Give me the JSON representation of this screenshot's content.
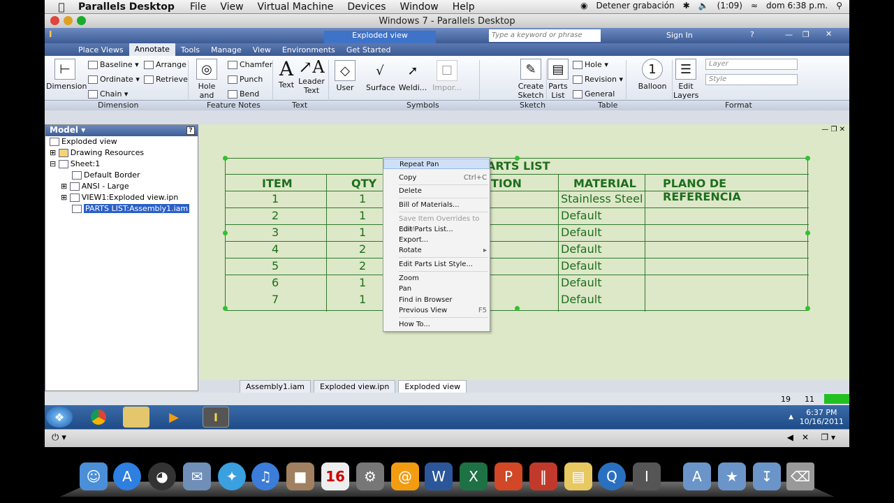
{
  "macbar": {
    "app": "Parallels Desktop",
    "menus": [
      "File",
      "View",
      "Virtual Machine",
      "Devices",
      "Window",
      "Help"
    ],
    "recording": "Detener grabación",
    "battery": "(1:09)",
    "clock": "dom 6:38 p.m."
  },
  "window_title": "Windows 7 - Parallels Desktop",
  "inventor": {
    "doc_title": "Exploded view",
    "search_placeholder": "Type a keyword or phrase",
    "sign_in": "Sign In",
    "tabs": [
      "Place Views",
      "Annotate",
      "Tools",
      "Manage",
      "View",
      "Environments",
      "Get Started"
    ],
    "ribbon": {
      "dimension": "Dimension",
      "baseline": "Baseline",
      "ordinate": "Ordinate",
      "chain": "Chain",
      "arrange": "Arrange",
      "retrieve": "Retrieve",
      "hole_thread": "Hole and Thread",
      "chamfer": "Chamfer",
      "punch": "Punch",
      "bend": "Bend",
      "text": "Text",
      "leader_text": "Leader Text",
      "user": "User",
      "surface": "Surface",
      "welding": "Weldi...",
      "import": "Impor...",
      "create_sketch": "Create Sketch",
      "parts_list": "Parts List",
      "hole": "Hole",
      "revision": "Revision",
      "general": "General",
      "balloon": "Balloon",
      "edit_layers": "Edit Layers",
      "layer": "Layer",
      "style": "Style"
    },
    "panels": [
      "Dimension",
      "Feature Notes",
      "Text",
      "Symbols",
      "Sketch",
      "Table",
      "Format"
    ],
    "browser": {
      "title": "Model",
      "items": [
        "Exploded view",
        "Drawing Resources",
        "Sheet:1",
        "Default Border",
        "ANSI - Large",
        "VIEW1:Exploded view.ipn",
        "PARTS LIST:Assembly1.iam"
      ]
    },
    "parts_list": {
      "title_fragment": "ARTS LIST",
      "headers": [
        "ITEM",
        "QTY",
        "TION",
        "MATERIAL",
        "PLANO DE REFERENCIA"
      ],
      "rows": [
        {
          "item": "1",
          "qty": "1",
          "material": "Stainless Steel"
        },
        {
          "item": "2",
          "qty": "1",
          "material": "Default"
        },
        {
          "item": "3",
          "qty": "1",
          "material": "Default"
        },
        {
          "item": "4",
          "qty": "2",
          "material": "Default"
        },
        {
          "item": "5",
          "qty": "2",
          "material": "Default"
        },
        {
          "item": "6",
          "qty": "1",
          "material": "Default"
        },
        {
          "item": "7",
          "qty": "1",
          "material": "Default"
        }
      ]
    },
    "context_menu": {
      "repeat_pan": "Repeat Pan",
      "copy": "Copy",
      "copy_sc": "Ctrl+C",
      "delete": "Delete",
      "bom": "Bill of Materials...",
      "save_overrides": "Save Item Overrides to BOM",
      "edit_parts_list": "Edit Parts List...",
      "export": "Export...",
      "rotate": "Rotate",
      "edit_style": "Edit Parts List Style...",
      "zoom": "Zoom",
      "pan": "Pan",
      "find_in_browser": "Find in Browser",
      "previous_view": "Previous View",
      "previous_sc": "F5",
      "how_to": "How To..."
    },
    "doc_tabs": [
      "Assembly1.iam",
      "Exploded view.ipn",
      "Exploded view"
    ],
    "status": {
      "a": "19",
      "b": "11"
    }
  },
  "taskbar": {
    "time": "6:37 PM",
    "date": "10/16/2011"
  },
  "colors": {
    "accent": "#1d6e1d",
    "canvas": "#dde8c8",
    "menu_highlight": "#cfe0f6"
  }
}
